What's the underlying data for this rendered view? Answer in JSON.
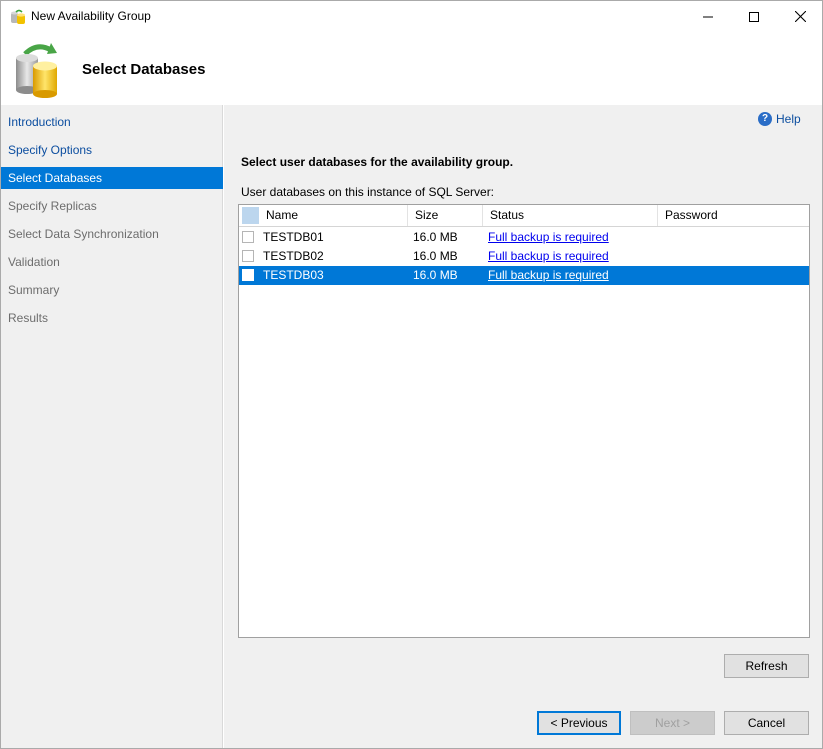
{
  "window": {
    "title": "New Availability Group",
    "icons": {
      "app": "database-group-icon",
      "minimize": "minimize-icon",
      "maximize": "maximize-icon",
      "close": "close-icon"
    }
  },
  "header": {
    "title": "Select Databases",
    "icon": "database-sync-icon"
  },
  "nav": {
    "items": [
      {
        "label": "Introduction",
        "state": "link"
      },
      {
        "label": "Specify Options",
        "state": "link"
      },
      {
        "label": "Select Databases",
        "state": "selected"
      },
      {
        "label": "Specify Replicas",
        "state": "disabled"
      },
      {
        "label": "Select Data Synchronization",
        "state": "disabled"
      },
      {
        "label": "Validation",
        "state": "disabled"
      },
      {
        "label": "Summary",
        "state": "disabled"
      },
      {
        "label": "Results",
        "state": "disabled"
      }
    ]
  },
  "main": {
    "help_label": "Help",
    "instruction": "Select user databases for the availability group.",
    "list_label": "User databases on this instance of SQL Server:",
    "columns": [
      "Name",
      "Size",
      "Status",
      "Password"
    ],
    "rows": [
      {
        "name": "TESTDB01",
        "size": "16.0 MB",
        "status": "Full backup is required",
        "password": "",
        "checked": false,
        "selected": false
      },
      {
        "name": "TESTDB02",
        "size": "16.0 MB",
        "status": "Full backup is required",
        "password": "",
        "checked": false,
        "selected": false
      },
      {
        "name": "TESTDB03",
        "size": "16.0 MB",
        "status": "Full backup is required",
        "password": "",
        "checked": false,
        "selected": true
      }
    ],
    "refresh_label": "Refresh"
  },
  "footer": {
    "previous_label": "< Previous",
    "next_label": "Next >",
    "cancel_label": "Cancel"
  },
  "colors": {
    "accent": "#0078d7",
    "link": "#0c4ea0",
    "panel": "#f0f0f0"
  }
}
